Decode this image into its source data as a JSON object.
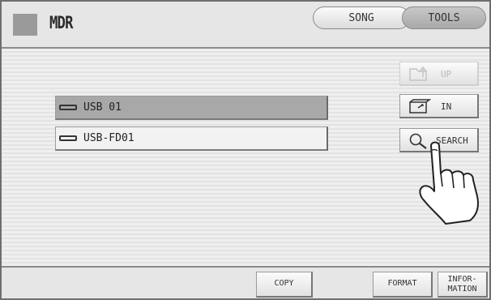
{
  "header": {
    "title": "MDR",
    "tabs": [
      {
        "label": "SONG"
      },
      {
        "label": "TOOLS"
      }
    ]
  },
  "devices": [
    {
      "label": "USB 01",
      "selected": true
    },
    {
      "label": "USB-FD01",
      "selected": false
    }
  ],
  "side_buttons": {
    "up": {
      "label": "UP",
      "enabled": false,
      "icon": "folder-up-icon"
    },
    "in": {
      "label": "IN",
      "enabled": true,
      "icon": "folder-in-icon"
    },
    "search": {
      "label": "SEARCH",
      "enabled": true,
      "icon": "magnifier-icon"
    }
  },
  "footer": {
    "copy": "COPY",
    "format": "FORMAT",
    "information": "INFOR-\nMATION"
  },
  "colors": {
    "selected_row": "#a8a8a8",
    "active_tab": "#b0b0b0",
    "background": "#ececec"
  }
}
